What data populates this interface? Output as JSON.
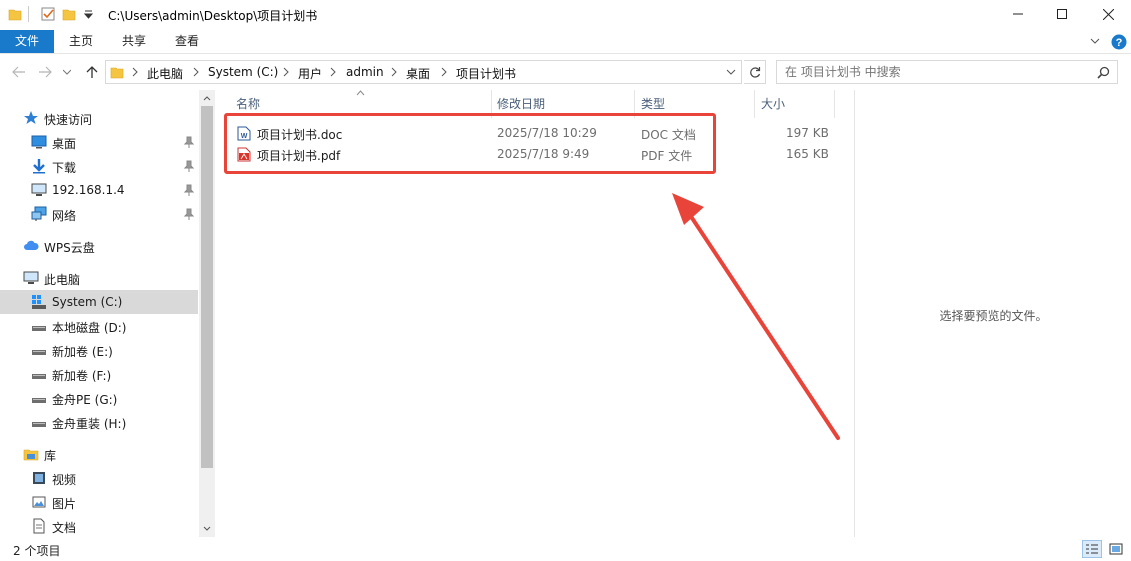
{
  "window": {
    "title": "C:\\Users\\admin\\Desktop\\项目计划书"
  },
  "ribbon": {
    "tabs": [
      "文件",
      "主页",
      "共享",
      "查看"
    ]
  },
  "address": {
    "crumbs": [
      "此电脑",
      "System (C:)",
      "用户",
      "admin",
      "桌面",
      "项目计划书"
    ],
    "search_placeholder": "在 项目计划书 中搜索"
  },
  "sidebar": {
    "quick_access": "快速访问",
    "pinned": [
      "桌面",
      "下载",
      "192.168.1.4",
      "网络"
    ],
    "wps": "WPS云盘",
    "this_pc": "此电脑",
    "drives": [
      "System (C:)",
      "本地磁盘 (D:)",
      "新加卷 (E:)",
      "新加卷 (F:)",
      "金舟PE (G:)",
      "金舟重装 (H:)"
    ],
    "library": "库",
    "library_items": [
      "视频",
      "图片",
      "文档"
    ]
  },
  "filelist": {
    "columns": [
      "名称",
      "修改日期",
      "类型",
      "大小"
    ],
    "files": [
      {
        "name": "项目计划书.doc",
        "modified": "2025/7/18 10:29",
        "type": "DOC 文档",
        "size": "197 KB",
        "icon": "word-doc-icon"
      },
      {
        "name": "项目计划书.pdf",
        "modified": "2025/7/18 9:49",
        "type": "PDF 文件",
        "size": "165 KB",
        "icon": "pdf-icon"
      }
    ]
  },
  "preview": {
    "message": "选择要预览的文件。"
  },
  "status": {
    "item_count": "2 个项目"
  },
  "colors": {
    "accent": "#1979ca",
    "annotation": "#e8443a"
  }
}
